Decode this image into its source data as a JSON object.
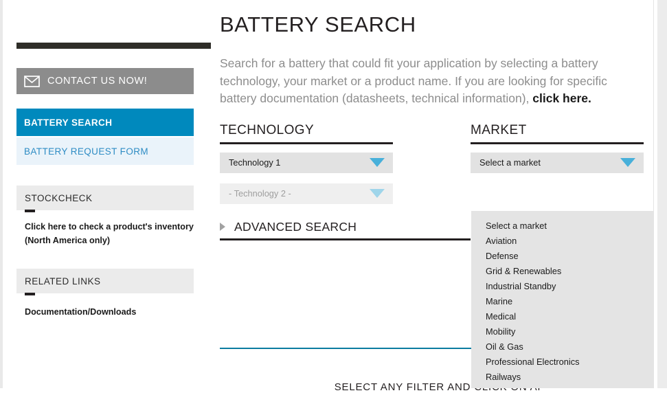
{
  "sidebar": {
    "contact_button": {
      "label": "CONTACT US NOW!",
      "icon": "envelope-icon"
    },
    "nav": [
      {
        "label": "BATTERY SEARCH",
        "state": "active"
      },
      {
        "label": "BATTERY REQUEST FORM",
        "state": "default"
      }
    ],
    "sections": [
      {
        "heading": "STOCKCHECK",
        "link": "Click here to check a product's inventory (North America only)"
      },
      {
        "heading": "RELATED LINKS",
        "link": "Documentation/Downloads"
      }
    ]
  },
  "main": {
    "title": "BATTERY SEARCH",
    "intro_text": "Search for a battery that could fit your application by selecting a battery technology, your market or a product name. If you are looking for specific battery documentation (datasheets, technical information), ",
    "intro_link": "click here.",
    "technology": {
      "heading": "TECHNOLOGY",
      "select_1_value": "Technology 1",
      "select_2_value": "- Technology 2 -",
      "advanced_search_label": "ADVANCED SEARCH"
    },
    "market": {
      "heading": "MARKET",
      "selected_value": "Select a market",
      "options": [
        "Select a market",
        "Aviation",
        "Defense",
        "Grid & Renewables",
        "Industrial Standby",
        "Marine",
        "Medical",
        "Mobility",
        "Oil & Gas",
        "Professional Electronics",
        "Railways"
      ]
    },
    "bottom_note": "SELECT ANY FILTER AND CLICK ON AP"
  },
  "colors": {
    "accent_blue": "#0089bd",
    "caret_blue": "#48b0da",
    "dark": "#231f20",
    "gray_button": "#8c8c8c",
    "rule_teal": "#0b7ca0"
  }
}
